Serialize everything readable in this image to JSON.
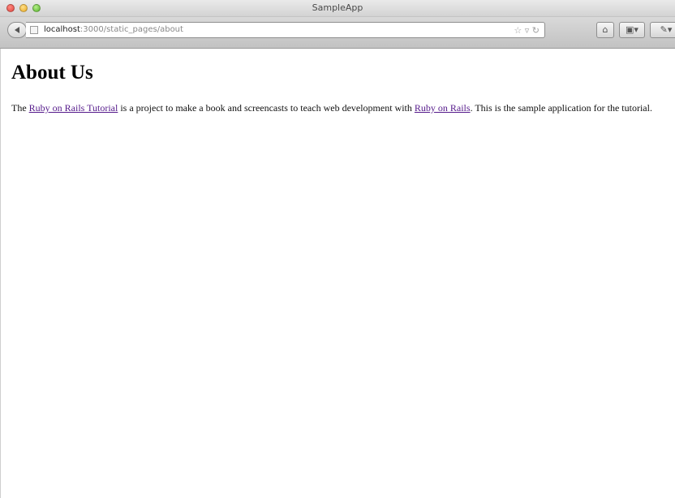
{
  "window": {
    "title": "SampleApp"
  },
  "address_bar": {
    "host": "localhost",
    "path": ":3000/static_pages/about"
  },
  "page": {
    "heading": "About Us",
    "paragraph": {
      "text_before": "The ",
      "link1": "Ruby on Rails Tutorial",
      "text_middle": " is a project to make a book and screencasts to teach web development with ",
      "link2": "Ruby on Rails",
      "text_after": ". This is the sample application for the tutorial."
    }
  },
  "colors": {
    "visited_link": "#551a8b",
    "close": "#e0443e",
    "minimize": "#e9a922",
    "maximize": "#57b22c"
  }
}
